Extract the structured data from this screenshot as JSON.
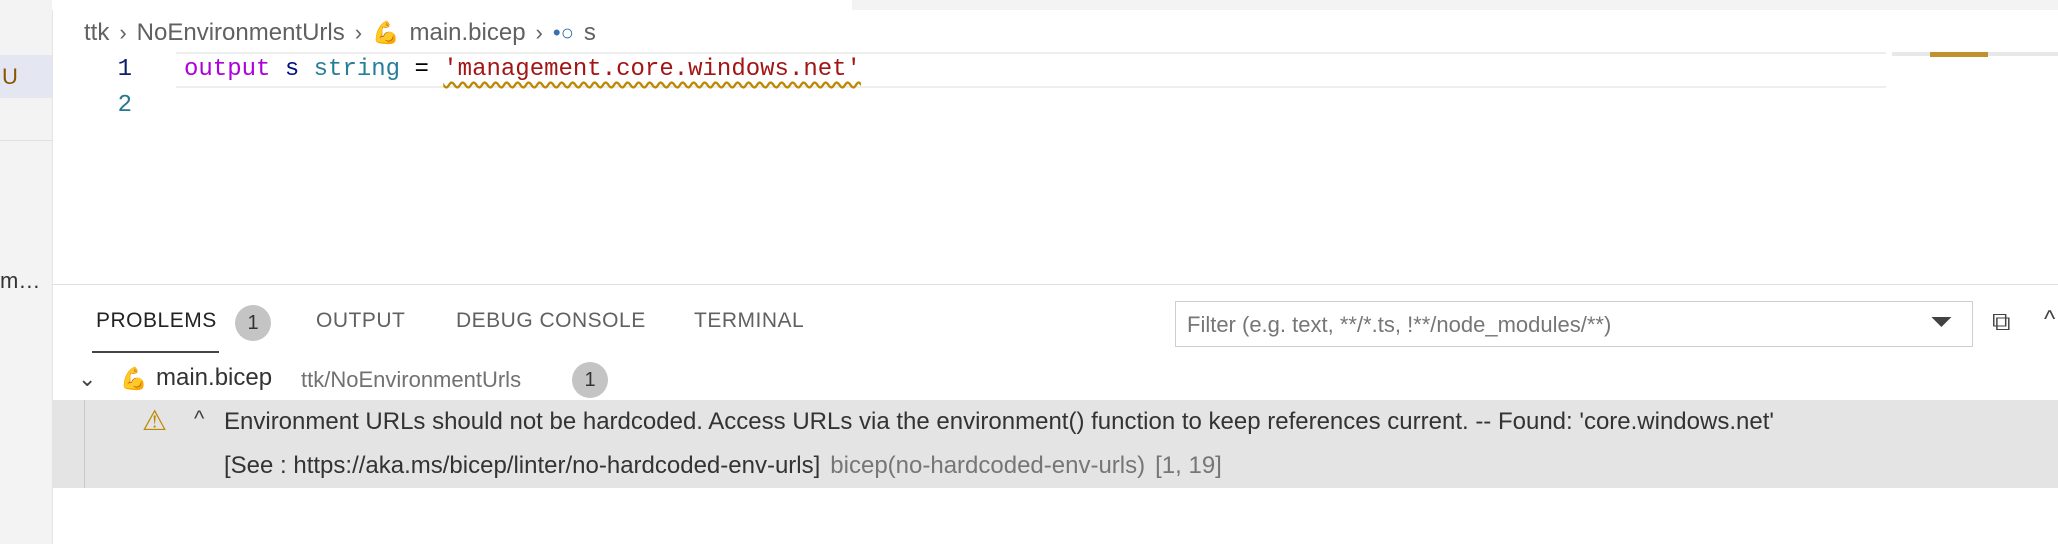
{
  "left": {
    "badge": "U",
    "truncated_label": "m…"
  },
  "breadcrumb": {
    "items": [
      "ttk",
      "NoEnvironmentUrls",
      "main.bicep",
      "s"
    ]
  },
  "editor": {
    "line_numbers": [
      "1",
      "2"
    ],
    "code": {
      "keyword": "output",
      "identifier": "s",
      "type": "string",
      "operator": "=",
      "string": "'management.core.windows.net'"
    }
  },
  "panel": {
    "tabs": {
      "problems": "PROBLEMS",
      "problems_count": "1",
      "output": "OUTPUT",
      "debug": "DEBUG CONSOLE",
      "terminal": "TERMINAL"
    },
    "filter_placeholder": "Filter (e.g. text, **/*.ts, !**/node_modules/**)"
  },
  "problems": {
    "file": "main.bicep",
    "path": "ttk/NoEnvironmentUrls",
    "count": "1",
    "message": "Environment URLs should not be hardcoded. Access URLs via the environment() function to keep references current. -- Found: 'core.windows.net'",
    "see": "[See : https://aka.ms/bicep/linter/no-hardcoded-env-urls]",
    "source": "bicep(no-hardcoded-env-urls)",
    "position": "[1, 19]"
  },
  "colors": {
    "warning": "#bf8803",
    "keyword": "#af00db",
    "string": "#a31515",
    "type": "#267f99"
  },
  "icons": [
    "chevron-right-icon",
    "bicep-file-icon",
    "property-icon",
    "filter-icon",
    "collapse-all-icon",
    "maximize-icon",
    "chevron-down-icon",
    "warning-icon",
    "chevron-up-icon"
  ]
}
